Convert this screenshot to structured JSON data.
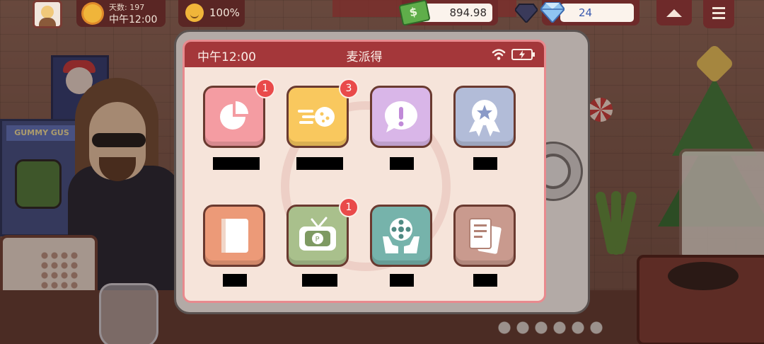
{
  "hud": {
    "day_label": "天数: 197",
    "day_time": "中午12:00",
    "mood_percent": "100%",
    "money": "894.98",
    "gems": "24"
  },
  "phone": {
    "status_time": "中午12:00",
    "app_title": "麦派得",
    "apps": [
      {
        "icon": "pie-chart-icon",
        "badge": "1",
        "color": "#f49ca2"
      },
      {
        "icon": "comet-icon",
        "badge": "3",
        "color": "#f9c85e"
      },
      {
        "icon": "exclamation-bubble-icon",
        "badge": "",
        "color": "#d9b6e8"
      },
      {
        "icon": "award-ribbon-icon",
        "badge": "",
        "color": "#b2bcd8"
      },
      {
        "icon": "book-icon",
        "badge": "",
        "color": "#ec9a78"
      },
      {
        "icon": "tv-icon",
        "badge": "1",
        "color": "#a9c08c"
      },
      {
        "icon": "film-reel-hands-icon",
        "badge": "",
        "color": "#76b3ab"
      },
      {
        "icon": "documents-icon",
        "badge": "",
        "color": "#c99a8e"
      }
    ]
  },
  "colors": {
    "status_bar": "#a4373a",
    "screen_bg": "#f6e4da",
    "badge": "#e94a4a"
  }
}
